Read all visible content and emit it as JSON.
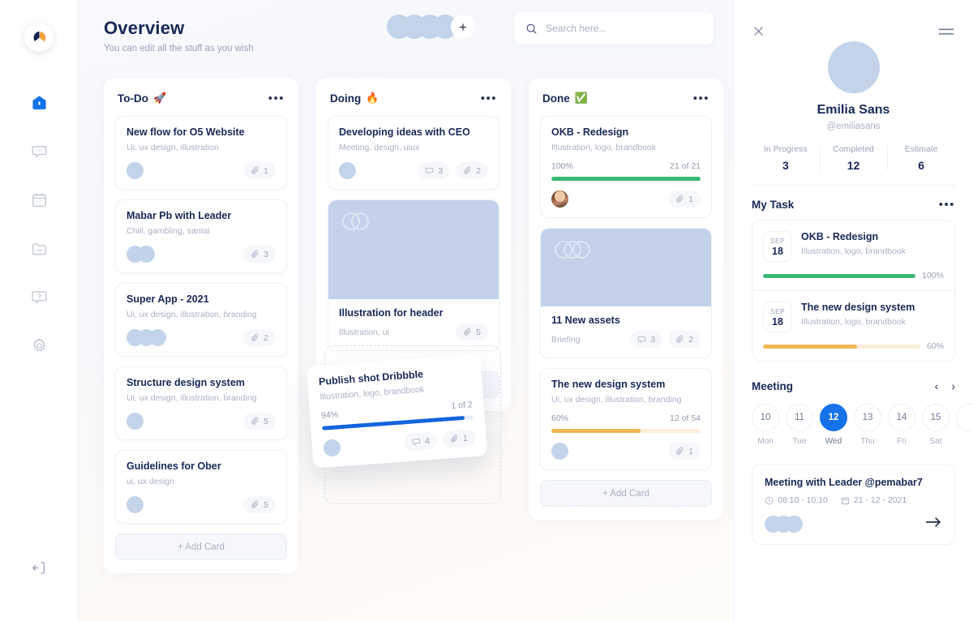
{
  "colors": {
    "accent_blue": "#1572e8",
    "green": "#3cb878",
    "amber": "#f0b653",
    "navy": "#182856",
    "muted": "#a9b1c4",
    "placeholder_blue": "#c3d1ea"
  },
  "sidebar": {
    "logo_name": "app-logo",
    "items": [
      {
        "icon": "home-icon",
        "name": "sidebar-item-home",
        "active": true
      },
      {
        "icon": "chat-icon",
        "name": "sidebar-item-messages",
        "active": false
      },
      {
        "icon": "calendar-icon",
        "name": "sidebar-item-calendar",
        "active": false
      },
      {
        "icon": "folder-icon",
        "name": "sidebar-item-files",
        "active": false
      },
      {
        "icon": "help-icon",
        "name": "sidebar-item-help",
        "active": false
      },
      {
        "icon": "gear-icon",
        "name": "sidebar-item-settings",
        "active": false
      }
    ],
    "logout_icon": "logout-icon"
  },
  "header": {
    "title": "Overview",
    "subtitle": "You can edit all the stuff as you wish",
    "member_count": 4,
    "add_member_label": "+"
  },
  "search": {
    "placeholder": "Search here...",
    "value": "",
    "icon": "search-icon"
  },
  "board": {
    "add_card_label": "+ Add Card",
    "columns": [
      {
        "title": "To-Do",
        "emoji": "🚀",
        "menu_icon": "more-options-icon",
        "cards": [
          {
            "title": "New flow for O5 Website",
            "tags": "Ui, ux design, illustration",
            "avatars": 1,
            "attachments": "1"
          },
          {
            "title": "Mabar Pb with Leader",
            "tags": "Chill, gambling, santai",
            "avatars": 2,
            "attachments": "3"
          },
          {
            "title": "Super App - 2021",
            "tags": "Ui, ux design, illustration, branding",
            "avatars": 3,
            "attachments": "2"
          },
          {
            "title": "Structure design system",
            "tags": "Ui, ux design, illustration, branding",
            "avatars": 1,
            "attachments": "5"
          },
          {
            "title": "Guidelines for Ober",
            "tags": "ui, ux design",
            "avatars": 1,
            "attachments": "5"
          }
        ]
      },
      {
        "title": "Doing",
        "emoji": "🔥",
        "menu_icon": "more-options-icon",
        "cards": [
          {
            "title": "Developing ideas with CEO",
            "tags": "Meeting, design, uiux",
            "avatars": 1,
            "comments": "3",
            "attachments": "2"
          },
          {
            "title": "Illustration for header",
            "tags": "Illustration, ui",
            "image": true,
            "attachments": "5"
          }
        ]
      },
      {
        "title": "Done",
        "emoji": "✅",
        "menu_icon": "more-options-icon",
        "cards": [
          {
            "title": "OKB - Redesign",
            "tags": "Illustration, logo, brandbook",
            "percent": "100%",
            "count": "21 of 21",
            "progress": 100,
            "bar_color": "#3cb878",
            "photo_avatar": true,
            "attachments": "1"
          },
          {
            "title": "11 New assets",
            "tags": "Briefing",
            "image": true,
            "comments": "3",
            "attachments": "2"
          },
          {
            "title": "The new design system",
            "tags": "Ui, ux design, illustration, branding",
            "percent": "60%",
            "count": "12 of 54",
            "progress": 60,
            "bar_color": "#f0b653",
            "avatars": 1,
            "attachments": "1"
          }
        ]
      }
    ],
    "dragged_card": {
      "title": "Publish shot Dribbble",
      "tags": "Illustration, logo, brandbook",
      "percent": "94%",
      "count": "1 of 2",
      "progress": 94,
      "bar_color": "#1364dd",
      "avatars": 1,
      "comments": "4",
      "attachments": "1"
    }
  },
  "panel": {
    "close_icon": "close-icon",
    "menu_icon": "hamburger-menu-icon",
    "profile": {
      "name": "Emilia Sans",
      "handle": "@emiliasans",
      "avatar_name": "user-avatar"
    },
    "stats": [
      {
        "label": "In Progress",
        "value": "3"
      },
      {
        "label": "Completed",
        "value": "12"
      },
      {
        "label": "Estimate",
        "value": "6"
      }
    ],
    "my_task": {
      "title": "My Task",
      "menu_icon": "more-options-icon",
      "items": [
        {
          "month": "SEP",
          "day": "18",
          "title": "OKB - Redesign",
          "subtitle": "Illustration, logo, brandbook",
          "percent": "100%",
          "progress": 100,
          "bar_color": "#3cb878"
        },
        {
          "month": "SEP",
          "day": "18",
          "title": "The new design system",
          "subtitle": "Illustration, logo, brandbook",
          "percent": "60%",
          "progress": 60,
          "bar_color": "#f0b653"
        }
      ]
    },
    "meeting": {
      "title": "Meeting",
      "prev_icon": "chevron-left-icon",
      "next_icon": "chevron-right-icon",
      "days": [
        {
          "num": "10",
          "name": "Mon",
          "active": false
        },
        {
          "num": "11",
          "name": "Tue",
          "active": false
        },
        {
          "num": "12",
          "name": "Wed",
          "active": true
        },
        {
          "num": "13",
          "name": "Thu",
          "active": false
        },
        {
          "num": "14",
          "name": "Fri",
          "active": false
        },
        {
          "num": "15",
          "name": "Sat",
          "active": false
        }
      ],
      "event": {
        "title": "Meeting with Leader @pemabar7",
        "time": "08:10 - 10:10",
        "date": "21 - 12 - 2021",
        "clock_icon": "clock-icon",
        "calendar_icon": "calendar-icon",
        "avatars": 3,
        "go_icon": "arrow-right-icon"
      }
    }
  }
}
